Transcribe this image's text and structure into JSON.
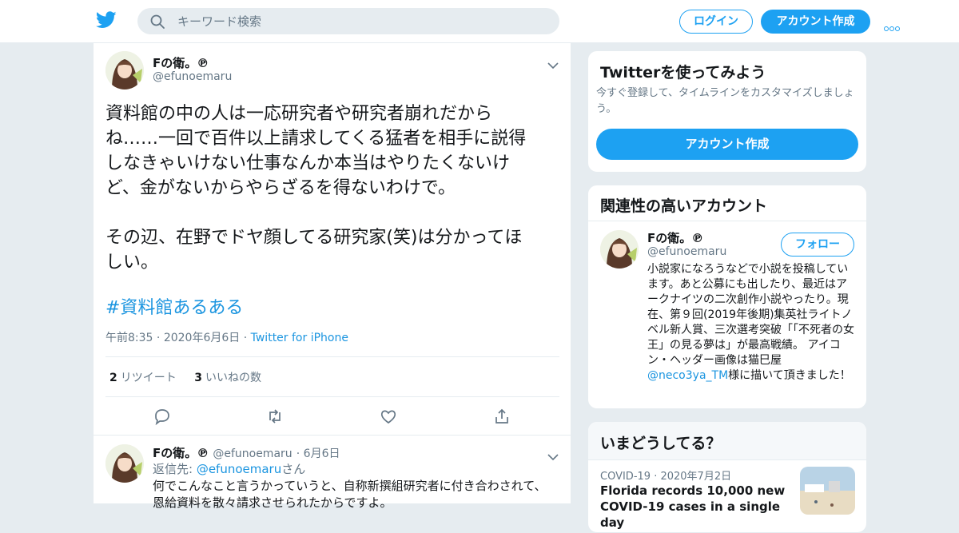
{
  "colors": {
    "accent": "#1da1f2",
    "link": "#1b95e0",
    "text": "#14171a",
    "muted": "#657786",
    "background": "#e6ecf0"
  },
  "topbar": {
    "logo_icon": "twitter-bird-icon",
    "search_placeholder": "キーワード検索",
    "login_label": "ログイン",
    "signup_label": "アカウント作成",
    "more_icon": "more-dots-icon"
  },
  "tweet": {
    "name": "Fの衛。℗",
    "handle": "@efunoemaru",
    "text": "資料館の中の人は一応研究者や研究者崩れだから\nね……一回で百件以上請求してくる猛者を相手に説得\nしなきゃいけない仕事なんか本当はやりたくないけ\nど、金がないからやらざるを得ないわけで。\n\nその辺、在野でドヤ顔してる研究家(笑)は分かってほ\nしい。",
    "hashtag": "#資料館あるある",
    "time": "午前8:35",
    "date": "2020年6月6日",
    "source": "Twitter for iPhone",
    "retweets_count": "2",
    "retweets_label": "リツイート",
    "likes_count": "3",
    "likes_label": "いいねの数",
    "actions": [
      "reply-icon",
      "retweet-icon",
      "like-icon",
      "share-icon"
    ]
  },
  "reply_tweet": {
    "name": "Fの衛。℗",
    "handle": "@efunoemaru",
    "date": "6月6日",
    "reply_prefix": "返信先: ",
    "reply_handle": "@efunoemaru",
    "reply_suffix": "さん",
    "text": "何でこんなこと言うかっていうと、自称新撰組研究者に付き合わされて、恩給資料を散々請求させられたからですよ。"
  },
  "sidebar": {
    "try_card": {
      "title": "Twitterを使ってみよう",
      "description": "今すぐ登録して、タイムラインをカスタマイズしましょう。",
      "button": "アカウント作成"
    },
    "related": {
      "title": "関連性の高いアカウント",
      "name": "Fの衛。℗",
      "handle": "@efunoemaru",
      "follow_label": "フォロー",
      "bio_before": "小説家になろうなどで小説を投稿しています。あと公募にも出したり、最近はアークナイツの二次創作小説やったり。現在、第９回(2019年後期)集英社ライトノベル新人賞、三次選考突破「「不死者の女王」の見る夢は」が最高戦績。 アイコン・ヘッダー画像は猫巳屋",
      "bio_link": "@neco3ya_TM",
      "bio_after": "様に描いて頂きました！"
    },
    "trends": {
      "title": "いまどうしてる？",
      "item_category": "COVID-19",
      "item_date": "2020年7月2日",
      "item_title": "Florida records 10,000 new COVID-19 cases in a single day"
    }
  }
}
